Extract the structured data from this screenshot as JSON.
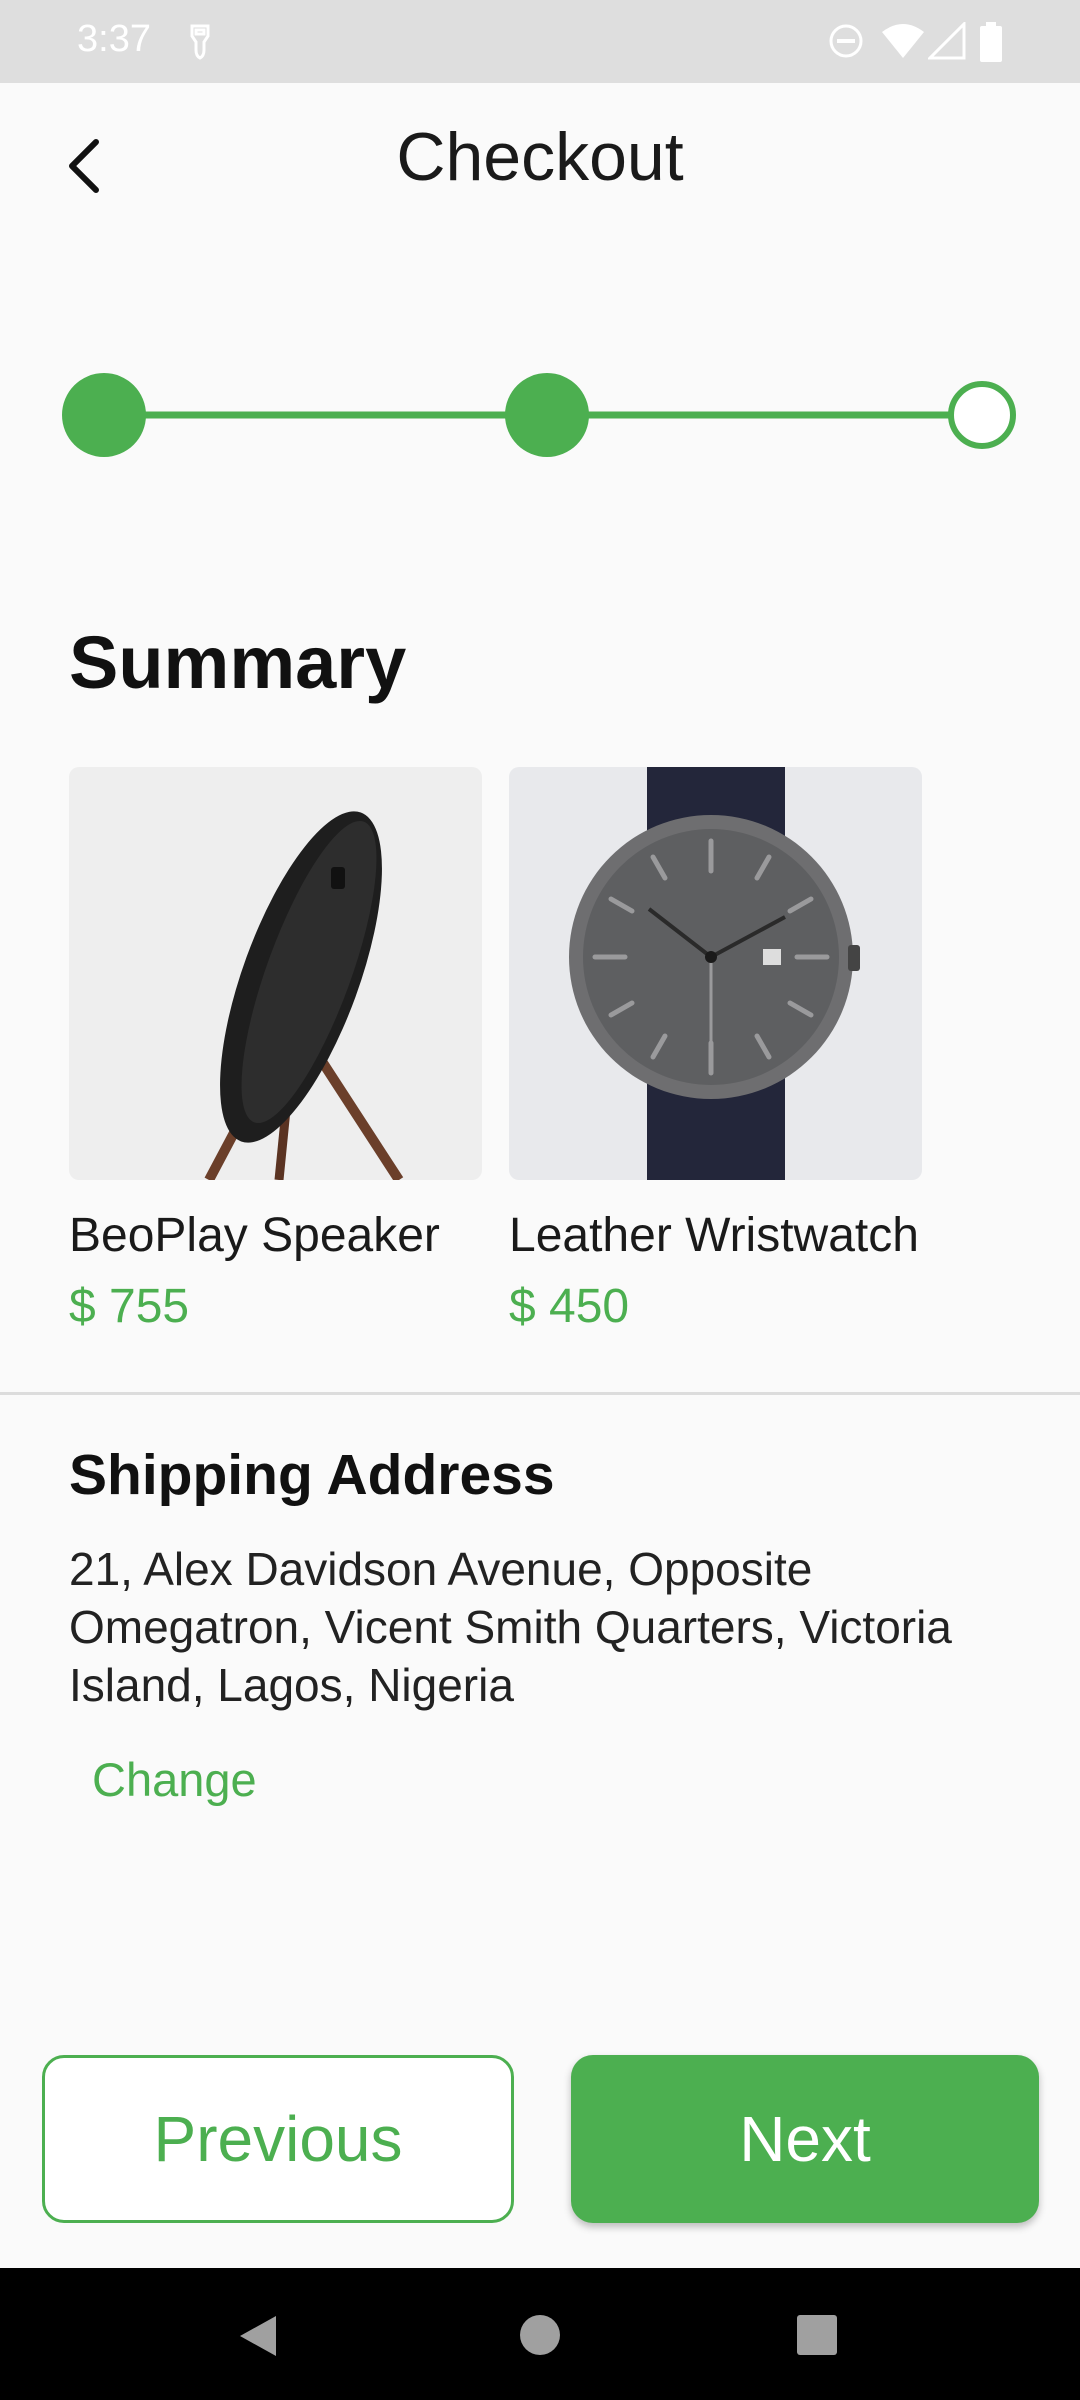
{
  "status_bar": {
    "time": "3:37",
    "icons": [
      "usb-icon",
      "dnd-icon",
      "wifi-icon",
      "signal-icon",
      "battery-icon"
    ]
  },
  "header": {
    "title": "Checkout",
    "back_icon": "chevron-left-icon"
  },
  "stepper": {
    "steps_total": 3,
    "current_step": 3,
    "completed_steps": 2
  },
  "summary": {
    "title": "Summary",
    "products": [
      {
        "name": "BeoPlay Speaker",
        "price": "$ 755",
        "image": "speaker-image"
      },
      {
        "name": "Leather Wristwatch",
        "price": "$ 450",
        "image": "wristwatch-image"
      }
    ]
  },
  "shipping": {
    "title": "Shipping Address",
    "address": "21, Alex Davidson Avenue, Opposite Omegatron, Vicent Smith Quarters, Victoria Island, Lagos, Nigeria",
    "change_label": "Change"
  },
  "actions": {
    "previous_label": "Previous",
    "next_label": "Next"
  },
  "nav_bar": {
    "icons": [
      "nav-back-icon",
      "nav-home-icon",
      "nav-recents-icon"
    ]
  },
  "colors": {
    "accent": "#4caf50",
    "background": "#fafafa"
  }
}
